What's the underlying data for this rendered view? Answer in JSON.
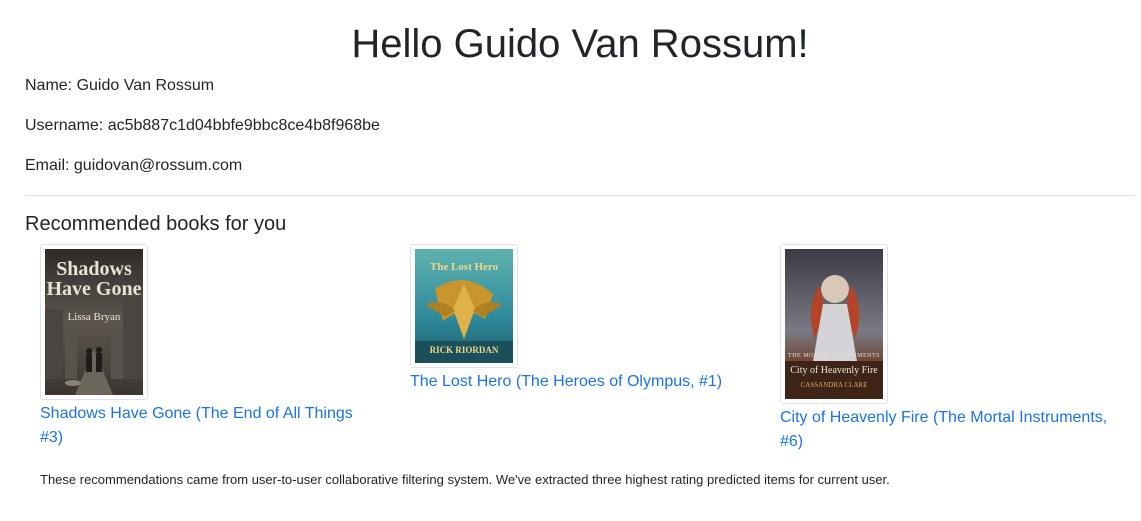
{
  "header": {
    "title": "Hello Guido Van Rossum!"
  },
  "profile": {
    "name": "Name: Guido Van Rossum",
    "username": "Username: ac5b887c1d04bbfe9bbc8ce4b8f968be",
    "email": "Email: guidovan@rossum.com"
  },
  "recommendations": {
    "title": "Recommended books for you",
    "books": [
      {
        "title": "Shadows Have Gone (The End of All Things #3)",
        "cover_title_line1": "Shadows",
        "cover_title_line2": "Have Gone",
        "cover_author": "Lissa Bryan"
      },
      {
        "title": "The Lost Hero (The Heroes of Olympus, #1)",
        "cover_title": "The Lost Hero",
        "cover_author": "RICK RIORDAN"
      },
      {
        "title": "City of Heavenly Fire (The Mortal Instruments, #6)",
        "cover_series": "THE MORTAL INSTRUMENTS",
        "cover_title": "City of Heavenly Fire",
        "cover_author": "CASSANDRA CLARE"
      }
    ],
    "note": "These recommendations came from user-to-user collaborative filtering system. We've extracted three highest rating predicted items for current user."
  },
  "colors": {
    "link": "#1a73e8",
    "text": "#212529",
    "divider": "#dcdcdc"
  }
}
